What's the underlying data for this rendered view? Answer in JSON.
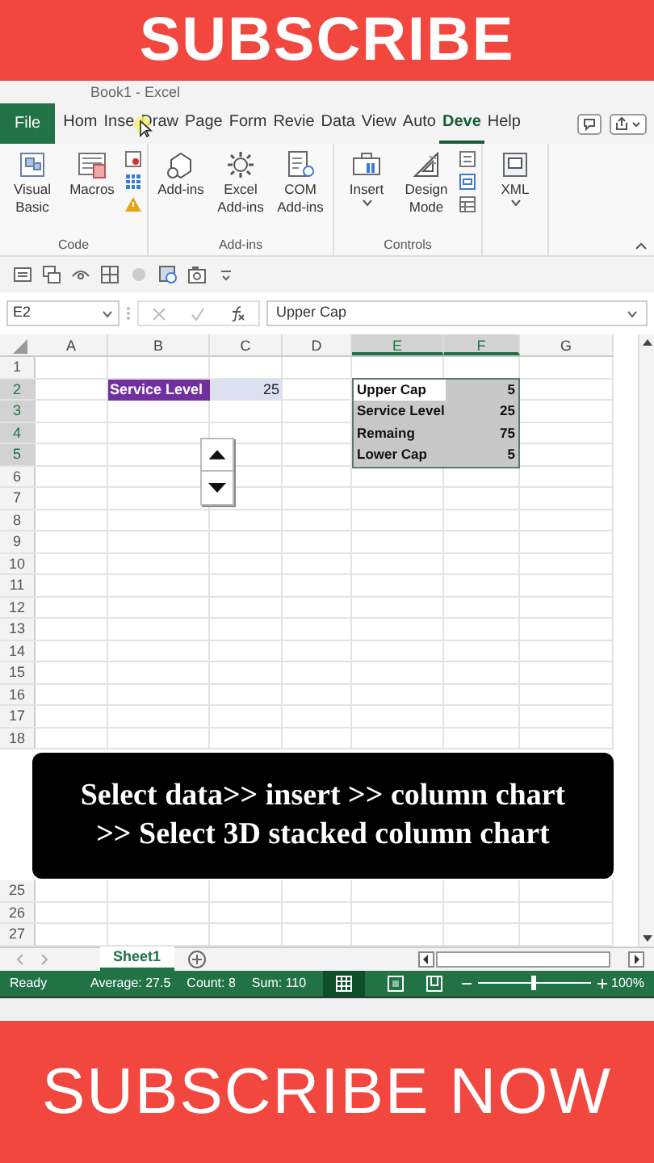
{
  "top_banner": {
    "text": "SUBSCRIBE"
  },
  "title_bar": {
    "title": "Book1 - Excel"
  },
  "tabs": [
    {
      "label": "File",
      "kind": "file",
      "selected": false
    },
    {
      "label": "Hom",
      "kind": "tab",
      "selected": false
    },
    {
      "label": "Inse",
      "kind": "tab",
      "selected": false
    },
    {
      "label": "Draw",
      "kind": "tab",
      "selected": false
    },
    {
      "label": "Page",
      "kind": "tab",
      "selected": false
    },
    {
      "label": "Form",
      "kind": "tab",
      "selected": false
    },
    {
      "label": "Revie",
      "kind": "tab",
      "selected": false
    },
    {
      "label": "Data",
      "kind": "tab",
      "selected": false
    },
    {
      "label": "View",
      "kind": "tab",
      "selected": false
    },
    {
      "label": "Auto",
      "kind": "tab",
      "selected": false
    },
    {
      "label": "Deve",
      "kind": "tab",
      "selected": true
    },
    {
      "label": "Help",
      "kind": "tab",
      "selected": false
    }
  ],
  "ribbon_groups": [
    {
      "label": "Code",
      "buttons": [
        {
          "label": "Visual Basic"
        },
        {
          "label": "Macros"
        }
      ]
    },
    {
      "label": "Add-ins",
      "buttons": [
        {
          "label": "Add-ins"
        },
        {
          "label": "Excel Add-ins"
        },
        {
          "label": "COM Add-ins"
        }
      ]
    },
    {
      "label": "Controls",
      "buttons": [
        {
          "label": "Insert",
          "caret": true
        },
        {
          "label": "Design Mode"
        }
      ]
    },
    {
      "buttons": [
        {
          "label": "XML",
          "caret": true
        }
      ]
    }
  ],
  "formula_bar": {
    "name_box": "E2",
    "formula": "Upper Cap"
  },
  "columns": [
    {
      "label": "A",
      "selected": false
    },
    {
      "label": "B",
      "selected": false
    },
    {
      "label": "C",
      "selected": false
    },
    {
      "label": "D",
      "selected": false
    },
    {
      "label": "E",
      "selected": true
    },
    {
      "label": "F",
      "selected": true
    },
    {
      "label": "G",
      "selected": false
    }
  ],
  "rows_top": [
    {
      "label": "1",
      "selected": false
    },
    {
      "label": "2",
      "selected": true
    },
    {
      "label": "3",
      "selected": true
    },
    {
      "label": "4",
      "selected": true
    },
    {
      "label": "5",
      "selected": true
    },
    {
      "label": "6",
      "selected": false
    },
    {
      "label": "7",
      "selected": false
    },
    {
      "label": "8",
      "selected": false
    },
    {
      "label": "9",
      "selected": false
    },
    {
      "label": "10",
      "selected": false
    },
    {
      "label": "11",
      "selected": false
    },
    {
      "label": "12",
      "selected": false
    },
    {
      "label": "13",
      "selected": false
    },
    {
      "label": "14",
      "selected": false
    },
    {
      "label": "15",
      "selected": false
    },
    {
      "label": "16",
      "selected": false
    },
    {
      "label": "17",
      "selected": false
    },
    {
      "label": "18",
      "selected": false
    }
  ],
  "rows_bottom": [
    {
      "label": "25",
      "selected": false
    },
    {
      "label": "26",
      "selected": false
    },
    {
      "label": "27",
      "selected": false
    }
  ],
  "service_level": {
    "label": "Service Level",
    "value": "25"
  },
  "summary_table": [
    {
      "label": "Upper Cap",
      "value": "5",
      "selected": true
    },
    {
      "label": "Service Level",
      "value": "25",
      "selected": false
    },
    {
      "label": "Remaing",
      "value": "75",
      "selected": false
    },
    {
      "label": "Lower Cap",
      "value": "5",
      "selected": false
    }
  ],
  "caption": [
    "Select data>> insert >> column chart",
    ">> Select 3D stacked column chart"
  ],
  "sheet_tabs": [
    {
      "label": "Sheet1",
      "selected": true
    }
  ],
  "status_bar": {
    "mode": "Ready",
    "average": "Average: 27.5",
    "count": "Count: 8",
    "sum": "Sum: 110",
    "zoom": "100%",
    "zoom_slider": {
      "level": 0.5
    }
  },
  "bottom_banner": {
    "text": "SUBSCRIBE NOW"
  }
}
